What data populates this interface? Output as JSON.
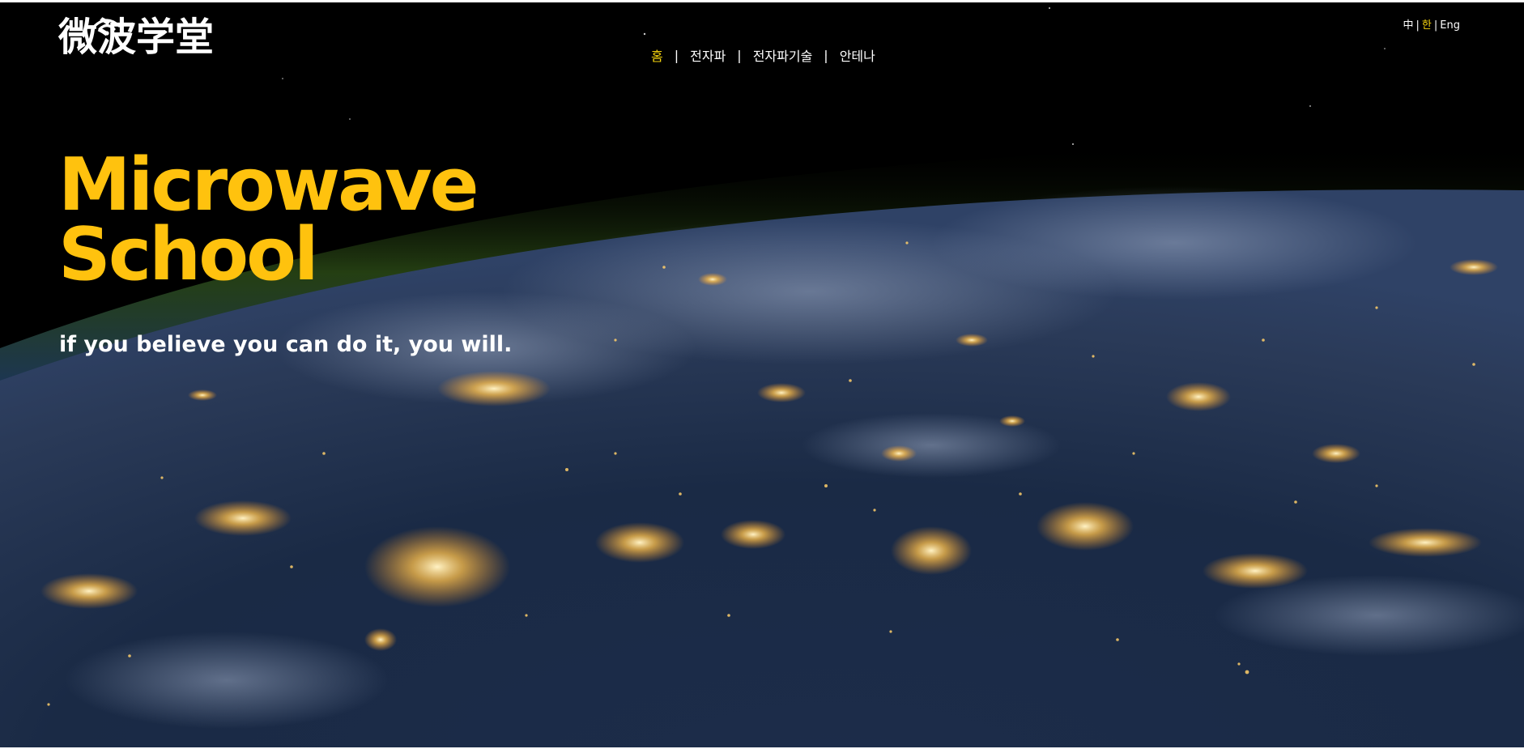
{
  "brand": {
    "logo_text": "微波学堂"
  },
  "nav": {
    "items": [
      {
        "label": "홈",
        "active": true
      },
      {
        "label": "전자파",
        "active": false
      },
      {
        "label": "전자파기술",
        "active": false
      },
      {
        "label": "안테나",
        "active": false
      }
    ],
    "separator": "|"
  },
  "lang": {
    "options": [
      {
        "label": "中",
        "active": false
      },
      {
        "label": "한",
        "active": true
      },
      {
        "label": "Eng",
        "active": false
      }
    ],
    "separator": "|"
  },
  "hero": {
    "title_line1": "Microwave",
    "title_line2": "School",
    "tagline": "if you believe you can do it, you will."
  },
  "colors": {
    "accent": "#ffc20e",
    "nav_active": "#f5d40e",
    "text": "#ffffff",
    "background": "#000000"
  },
  "icons": {
    "logo_signal": "wifi-icon"
  }
}
